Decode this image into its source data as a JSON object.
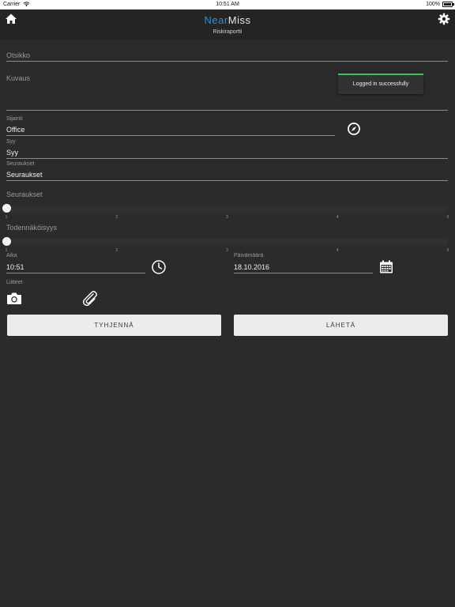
{
  "status_bar": {
    "carrier": "Carrier",
    "time": "10:51 AM",
    "battery": "100%",
    "battery_level": 1.0
  },
  "nav": {
    "brand_near": "Near",
    "brand_miss": "Miss",
    "subtitle": "Riskiraportti",
    "left_icon": "home-icon",
    "right_icon": "gear-icon",
    "brand_color": "#2e8fd6"
  },
  "form": {
    "title_placeholder": "Otsikko",
    "description_placeholder": "Kuvaus",
    "location": {
      "label": "Sijainti",
      "value": "Office",
      "icon": "compass-icon"
    },
    "cause": {
      "label": "Syy",
      "value": "Syy"
    },
    "consequences": {
      "label": "Seuraukset",
      "value": "Seuraukset"
    },
    "severity_slider": {
      "label": "Seuraukset",
      "value": 1,
      "min": 1,
      "max": 5,
      "ticks": [
        "1",
        "2",
        "3",
        "4",
        "5"
      ]
    },
    "probability_slider": {
      "label": "Todennäköisyys",
      "value": 1,
      "min": 1,
      "max": 5,
      "ticks": [
        "1",
        "2",
        "3",
        "4",
        "5"
      ]
    },
    "time": {
      "label": "Aika",
      "value": "10:51",
      "icon": "clock-icon"
    },
    "date": {
      "label": "Päivämäärä",
      "value": "18.10.2016",
      "icon": "calendar-icon"
    },
    "attachments": {
      "label": "Liitteet",
      "camera_icon": "camera-icon",
      "clip_icon": "paperclip-icon"
    }
  },
  "buttons": {
    "clear": "TYHJENNÄ",
    "send": "LÄHETÄ"
  },
  "toast": {
    "message": "Logged in successfully",
    "accent": "#39c35e"
  }
}
